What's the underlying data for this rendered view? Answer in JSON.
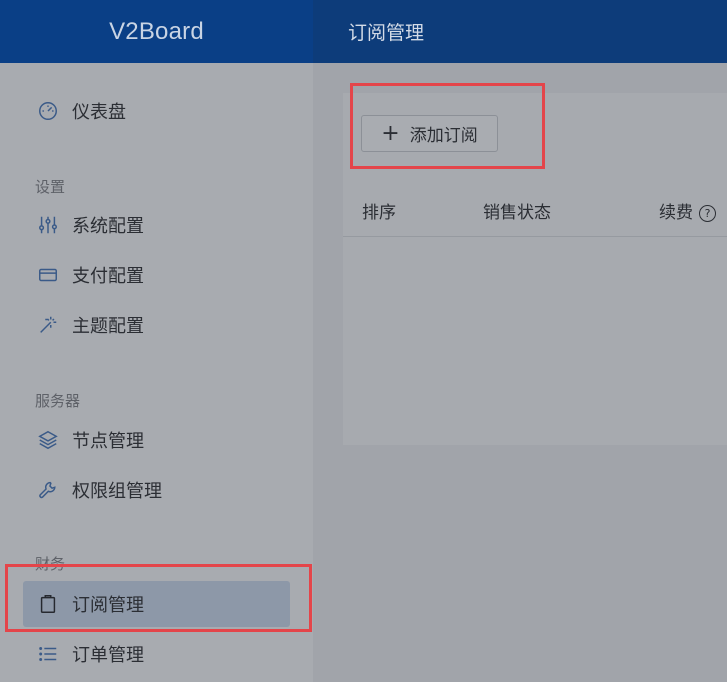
{
  "app": {
    "logo": "V2Board",
    "page_title": "订阅管理"
  },
  "sidebar": {
    "top_items": [
      {
        "label": "仪表盘",
        "icon": "dashboard-icon"
      }
    ],
    "sections": [
      {
        "label": "设置",
        "items": [
          {
            "label": "系统配置",
            "icon": "sliders-icon"
          },
          {
            "label": "支付配置",
            "icon": "credit-card-icon"
          },
          {
            "label": "主题配置",
            "icon": "magic-wand-icon"
          }
        ]
      },
      {
        "label": "服务器",
        "items": [
          {
            "label": "节点管理",
            "icon": "layers-icon"
          },
          {
            "label": "权限组管理",
            "icon": "wrench-icon"
          }
        ]
      },
      {
        "label": "财务",
        "items": [
          {
            "label": "订阅管理",
            "icon": "clipboard-icon",
            "active": true
          },
          {
            "label": "订单管理",
            "icon": "list-icon"
          }
        ]
      }
    ]
  },
  "main": {
    "add_button": {
      "icon": "+",
      "label": "添加订阅"
    },
    "table": {
      "columns": [
        "排序",
        "销售状态",
        "续费"
      ],
      "help_glyph": "?"
    }
  },
  "colors": {
    "highlight": "#e4454a",
    "header": "#0a3f86",
    "active_item": "#8d98a8"
  }
}
